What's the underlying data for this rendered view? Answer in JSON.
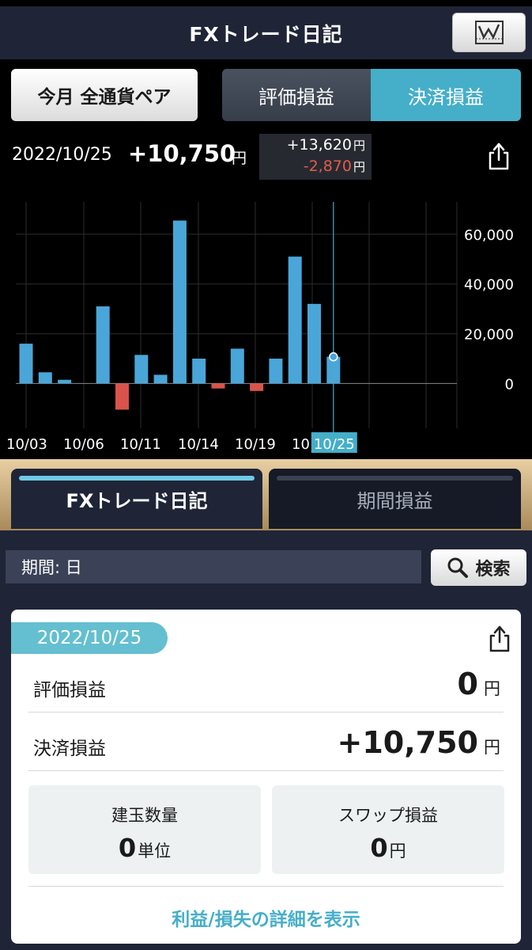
{
  "header": {
    "title": "FXトレード日記"
  },
  "controls": {
    "currency_label": "今月 全通貨ペア",
    "segments": [
      "評価損益",
      "決済損益"
    ],
    "active_segment": 1
  },
  "summary": {
    "date": "2022/10/25",
    "total": "+10,750",
    "unit": "円",
    "profit": "+13,620",
    "loss": "-2,870"
  },
  "chart_data": {
    "type": "bar",
    "x_tick_labels": [
      "10/03",
      "10/06",
      "10/11",
      "10/14",
      "10/19",
      "10",
      "10/25"
    ],
    "values": [
      16000,
      4500,
      1500,
      0,
      31000,
      -10500,
      11500,
      3500,
      65500,
      10000,
      -2000,
      14000,
      -3000,
      10000,
      51000,
      32000,
      10750
    ],
    "selected_index": 16,
    "ylim": [
      -18000,
      73000
    ],
    "yticks": [
      0,
      20000,
      40000,
      60000
    ],
    "ytick_labels": [
      "0",
      "20,000",
      "40,000",
      "60,000"
    ],
    "selected_label": "10/25",
    "colors": {
      "positive": "#4aa6d8",
      "negative": "#d9534a"
    },
    "grid": true
  },
  "tabs": {
    "active": "FXトレード日記",
    "inactive": "期間損益"
  },
  "filter": {
    "period": "期間: 日",
    "search_label": "検索"
  },
  "card": {
    "date": "2022/10/25",
    "valuation_label": "評価損益",
    "valuation_value": "0",
    "settled_label": "決済損益",
    "settled_value": "+10,750",
    "unit": "円",
    "positions_label": "建玉数量",
    "positions_value": "0",
    "positions_unit": "単位",
    "swap_label": "スワップ損益",
    "swap_value": "0",
    "swap_unit": "円",
    "detail_link": "利益/損失の詳細を表示"
  },
  "colors": {
    "accent": "#45aec9",
    "header_bg": "#1f2537"
  }
}
